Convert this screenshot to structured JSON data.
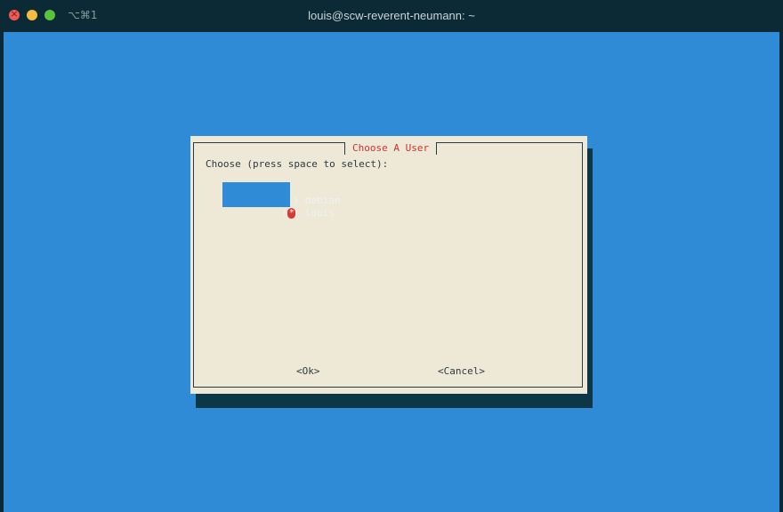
{
  "window": {
    "title": "louis@scw-reverent-neumann: ~",
    "shortcut": "⌥⌘1"
  },
  "dialog": {
    "title": "Choose A User",
    "prompt": "Choose (press space to select):",
    "options": [
      {
        "label": "debian",
        "selected": false,
        "marker": " "
      },
      {
        "label": "louis",
        "selected": true,
        "marker": "*"
      }
    ],
    "buttons": {
      "ok": "<Ok>",
      "cancel": "<Cancel>"
    }
  },
  "colors": {
    "terminal_background": "#2f8bd5",
    "dialog_background": "#eee8d6",
    "title_text": "#d0332e",
    "selection": "#2f8bd5"
  }
}
